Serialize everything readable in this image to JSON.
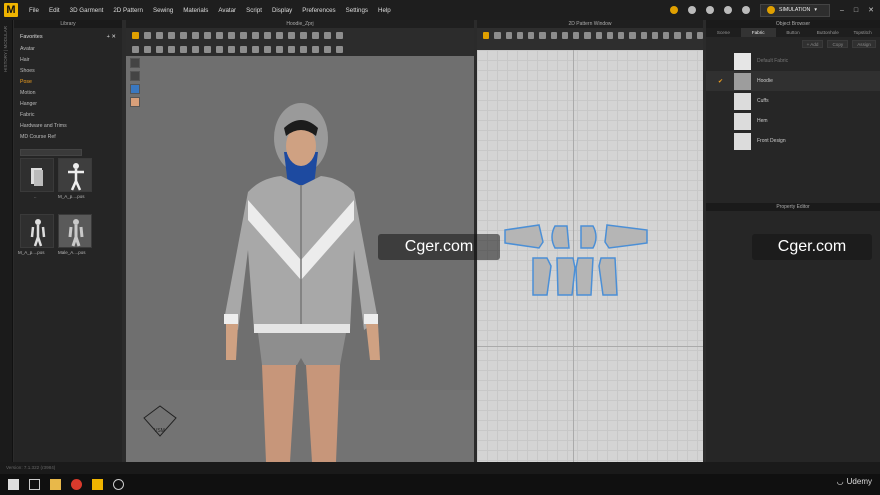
{
  "app": {
    "logo": "M",
    "menu": [
      "File",
      "Edit",
      "3D Garment",
      "2D Pattern",
      "Sewing",
      "Materials",
      "Avatar",
      "Script",
      "Display",
      "Preferences",
      "Settings",
      "Help"
    ],
    "mode": "SIMULATION"
  },
  "library": {
    "title": "Library",
    "favorites": "Favorites",
    "items": [
      "Avatar",
      "Hair",
      "Shoes",
      "Pose",
      "Motion",
      "Hanger",
      "Fabric",
      "Hardware and Trims",
      "MD Course Ref"
    ],
    "active": "Pose",
    "thumbs": [
      "..",
      "M_A_p....pos",
      "M_A_p....pos",
      "Male_A....pos"
    ]
  },
  "viewport3d": {
    "title": "Hoodie_Zprj",
    "view_label": "VSM"
  },
  "viewport2d": {
    "title": "2D Pattern Window"
  },
  "objectBrowser": {
    "title": "Object Browser",
    "tabs": [
      "Scene",
      "Fabric",
      "Button",
      "Buttonhole",
      "Topstitch"
    ],
    "active_tab": "Fabric",
    "buttons": [
      "+ Add",
      "Copy",
      "Assign"
    ],
    "fabrics": [
      {
        "name": "Default Fabric",
        "checked": false
      },
      {
        "name": "Hoodie",
        "checked": true
      },
      {
        "name": "Cuffs",
        "checked": false
      },
      {
        "name": "Hem",
        "checked": false
      },
      {
        "name": "Front Design",
        "checked": false
      }
    ]
  },
  "propertyEditor": {
    "title": "Property Editor"
  },
  "watermark": "Cger.com",
  "udemy": "Udemy",
  "status": "Version: 7.1.322   (r3984)"
}
